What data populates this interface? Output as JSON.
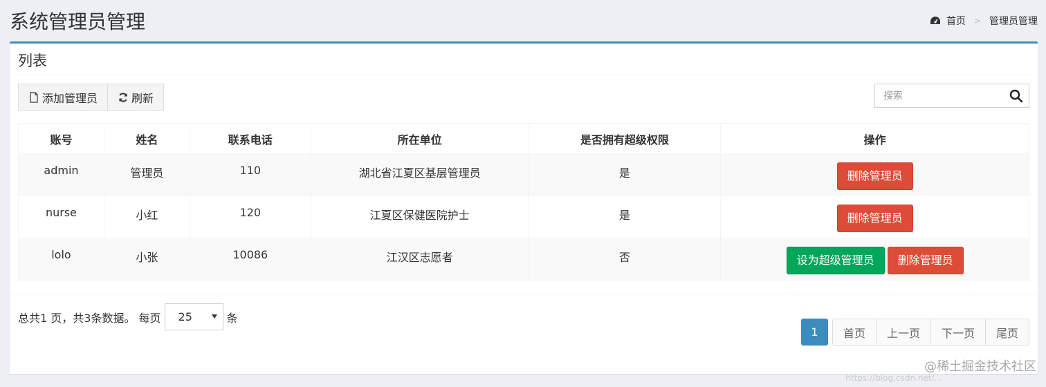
{
  "page": {
    "title": "系统管理员管理"
  },
  "breadcrumb": {
    "home": "首页",
    "separator": ">",
    "current": "管理员管理"
  },
  "box": {
    "title": "列表"
  },
  "toolbar": {
    "add_label": "添加管理员",
    "refresh_label": "刷新"
  },
  "search": {
    "placeholder": "搜索"
  },
  "table": {
    "headers": [
      "账号",
      "姓名",
      "联系电话",
      "所在单位",
      "是否拥有超级权限",
      "操作"
    ],
    "rows": [
      {
        "account": "admin",
        "name": "管理员",
        "phone": "110",
        "unit": "湖北省江夏区基层管理员",
        "super": "是",
        "set_super": "",
        "delete": "删除管理员"
      },
      {
        "account": "nurse",
        "name": "小红",
        "phone": "120",
        "unit": "江夏区保健医院护士",
        "super": "是",
        "set_super": "",
        "delete": "删除管理员"
      },
      {
        "account": "lolo",
        "name": "小张",
        "phone": "10086",
        "unit": "江汉区志愿者",
        "super": "否",
        "set_super": "设为超级管理员",
        "delete": "删除管理员"
      }
    ]
  },
  "summary": {
    "info": "总共1 页，共3条数据。 每页",
    "page_size": "25",
    "unit": "条"
  },
  "pagination": {
    "current": "1",
    "first": "首页",
    "prev": "上一页",
    "next": "下一页",
    "last": "尾页"
  },
  "watermark": {
    "text": "@稀土掘金技术社区",
    "url": "https://blog.csdn.net/..."
  },
  "colors": {
    "primary": "#3c8dbc",
    "danger": "#dd4b39",
    "success": "#00a65a"
  }
}
